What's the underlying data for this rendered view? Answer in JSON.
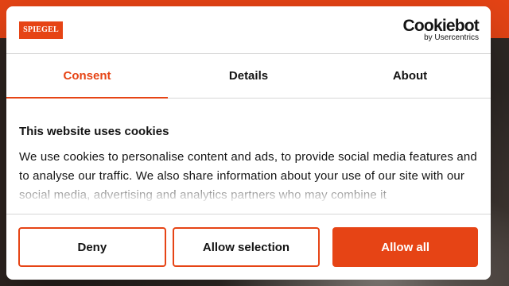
{
  "site": {
    "logo_text": "SPIEGEL",
    "brand_color": "#e64415"
  },
  "cookiebot": {
    "brand": "Cookiebot",
    "byline": "by Usercentrics"
  },
  "tabs": [
    {
      "label": "Consent",
      "active": true
    },
    {
      "label": "Details",
      "active": false
    },
    {
      "label": "About",
      "active": false
    }
  ],
  "content": {
    "heading": "This website uses cookies",
    "body": "We use cookies to personalise content and ads, to provide social media features and to analyse our traffic. We also share information about your use of our site with our social media, advertising and analytics partners who may combine it"
  },
  "buttons": {
    "deny": "Deny",
    "allow_selection": "Allow selection",
    "allow_all": "Allow all"
  }
}
